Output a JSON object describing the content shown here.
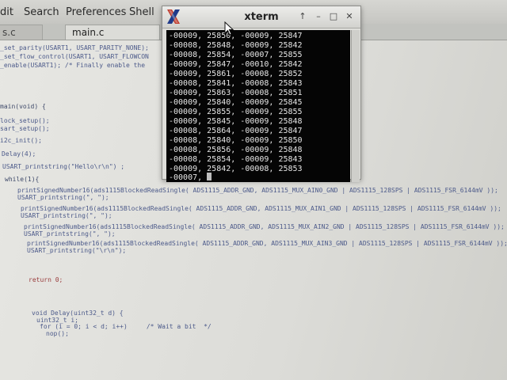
{
  "menubar": {
    "items": [
      "dit",
      "Search",
      "Preferences",
      "Shell"
    ]
  },
  "tabs": [
    {
      "label": "s.c",
      "active": false
    },
    {
      "label": "main.c",
      "active": true
    }
  ],
  "code": {
    "lines": [
      "_set_parity(USART1, USART_PARITY_NONE);",
      "_set_flow_control(USART1, USART_FLOWCON",
      "_enable(USART1); /* Finally enable the",
      "main(void) {",
      "lock_setup();",
      "sart_setup();",
      "i2c_init();",
      "Delay(4);",
      "USART_printstring(\"Hello\\r\\n\") ;",
      "while(1){",
      "printSignedNumber16(ads1115BlockedReadSingle( ADS1115_ADDR_GND, ADS1115_MUX_AIN0_GND | ADS1115_128SPS | ADS1115_FSR_6144mV ));",
      "USART_printstring(\", \");",
      "printSignedNumber16(ads1115BlockedReadSingle( ADS1115_ADDR_GND, ADS1115_MUX_AIN1_GND | ADS1115_128SPS | ADS1115_FSR_6144mV ));",
      "USART_printstring(\", \");",
      "printSignedNumber16(ads1115BlockedReadSingle( ADS1115_ADDR_GND, ADS1115_MUX_AIN2_GND | ADS1115_128SPS | ADS1115_FSR_6144mV ));",
      "USART_printstring(\", \");",
      "printSignedNumber16(ads1115BlockedReadSingle( ADS1115_ADDR_GND, ADS1115_MUX_AIN3_GND | ADS1115_128SPS | ADS1115_FSR_6144mV ));",
      "USART_printstring(\"\\r\\n\");",
      "return 0;",
      "void Delay(uint32_t d) {",
      "uint32_t i;",
      "for (i = 0; i < d; i++)     /* Wait a bit  */",
      "nop();"
    ]
  },
  "xterm": {
    "title": "xterm",
    "buttons": [
      "↑",
      "–",
      "□",
      "✕"
    ],
    "lines": [
      "-00009, 25850, -00009, 25847",
      "-00008, 25848, -00009, 25842",
      "-00008, 25854, -00007, 25855",
      "-00009, 25847, -00010, 25842",
      "-00009, 25861, -00008, 25852",
      "-00008, 25841, -00008, 25843",
      "-00009, 25863, -00008, 25851",
      "-00009, 25840, -00009, 25845",
      "-00009, 25855, -00009, 25855",
      "-00009, 25845, -00009, 25848",
      "-00008, 25864, -00009, 25847",
      "-00008, 25840, -00009, 25850",
      "-00008, 25856, -00009, 25848",
      "-00008, 25854, -00009, 25843",
      "-00009, 25842, -00008, 25853"
    ],
    "partial": "-00007, "
  },
  "colors": {
    "terminal_bg": "#050505",
    "terminal_fg": "#e6e6e6",
    "xterm_logo": "#c0392b"
  }
}
